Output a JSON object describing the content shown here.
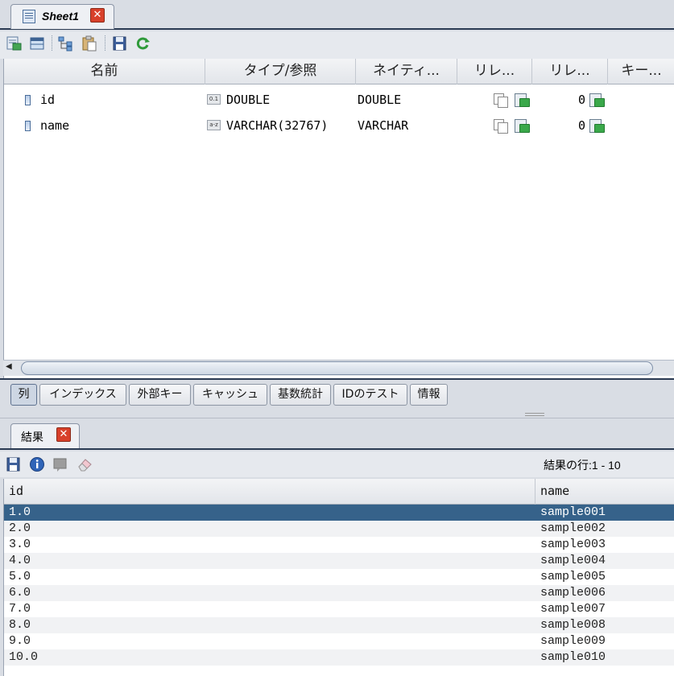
{
  "editor_tab": {
    "label": "Sheet1"
  },
  "toolbar": {
    "icons": [
      "export-icon",
      "table-icon",
      "tree-icon",
      "paste-icon",
      "save-icon",
      "refresh-icon"
    ]
  },
  "columns_table": {
    "headers": [
      "名前",
      "タイプ/参照",
      "ネイティ...",
      "リレ...",
      "リレ...",
      "キー..."
    ],
    "rows": [
      {
        "name": "id",
        "type": "DOUBLE",
        "type_badge": "0.1",
        "native": "DOUBLE",
        "rel_count": "0"
      },
      {
        "name": "name",
        "type": "VARCHAR(32767)",
        "type_badge": "a-z",
        "native": "VARCHAR",
        "rel_count": "0"
      }
    ]
  },
  "scrollbar": {
    "left_arrow": "◀"
  },
  "sub_tabs": [
    "列",
    "インデックス",
    "外部キー",
    "キャッシュ",
    "基数統計",
    "IDのテスト",
    "情報"
  ],
  "results_tab": {
    "label": "結果"
  },
  "results_toolbar": {
    "row_count": "結果の行:1 - 10",
    "icons": [
      "save-icon",
      "info-icon",
      "comment-icon",
      "eraser-icon"
    ]
  },
  "result_grid": {
    "headers": [
      "id",
      "name"
    ],
    "rows": [
      [
        "1.0",
        "sample001"
      ],
      [
        "2.0",
        "sample002"
      ],
      [
        "3.0",
        "sample003"
      ],
      [
        "4.0",
        "sample004"
      ],
      [
        "5.0",
        "sample005"
      ],
      [
        "6.0",
        "sample006"
      ],
      [
        "7.0",
        "sample007"
      ],
      [
        "8.0",
        "sample008"
      ],
      [
        "9.0",
        "sample009"
      ],
      [
        "10.0",
        "sample010"
      ]
    ],
    "selected_row": 0
  },
  "colors": {
    "selection": "#36628a",
    "close_button": "#d8402a",
    "frame_dark": "#2a3a52"
  }
}
